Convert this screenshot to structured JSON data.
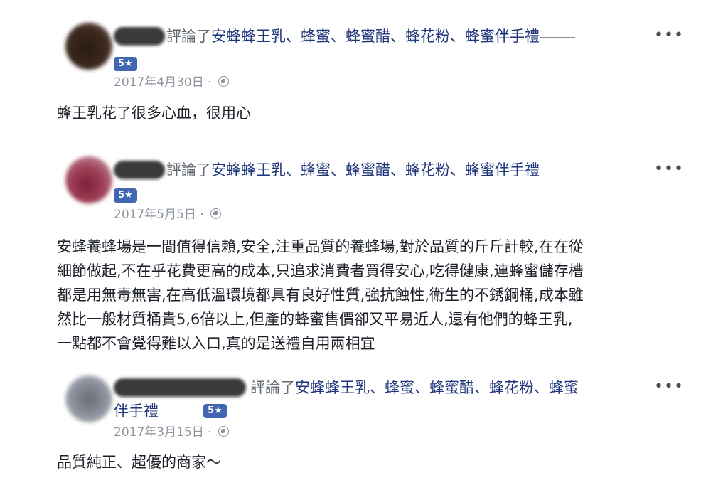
{
  "reviews": [
    {
      "verb": "評論了",
      "page_name": "安蜂蜂王乳、蜂蜜、蜂蜜醋、蜂花粉、蜂蜜伴手禮",
      "rating_badge": "5★",
      "date": "2017年4月30日",
      "date_sep": " · ",
      "body_lines": [
        "蜂王乳花了很多心血，很用心"
      ],
      "more_label": "•••"
    },
    {
      "verb": "評論了",
      "page_name": "安蜂蜂王乳、蜂蜜、蜂蜜醋、蜂花粉、蜂蜜伴手禮",
      "rating_badge": "5★",
      "date": "2017年5月5日",
      "date_sep": " · ",
      "body_lines": [
        "安蜂養蜂場是一間值得信賴,安全,注重品質的養蜂場,對於品質的斤斤計較,在在從",
        "細節做起,不在乎花費更高的成本,只追求消費者買得安心,吃得健康,連蜂蜜儲存槽",
        "都是用無毒無害,在高低溫環境都具有良好性質,強抗蝕性,衛生的不銹鋼桶,成本雖",
        "然比一般材質桶貴5,6倍以上,但產的蜂蜜售價卻又平易近人,還有他們的蜂王乳,",
        "一點都不會覺得難以入口,真的是送禮自用兩相宜"
      ],
      "more_label": "•••"
    },
    {
      "verb": "評論了",
      "page_name_line1": "安蜂蜂王乳、蜂蜜、蜂蜜醋、蜂花粉、蜂蜜",
      "page_name_line2": "伴手禮",
      "rating_badge": "5★",
      "date": "2017年3月15日",
      "date_sep": " · ",
      "body_lines": [
        "品質純正、超優的商家～"
      ],
      "more_label": "•••"
    }
  ]
}
